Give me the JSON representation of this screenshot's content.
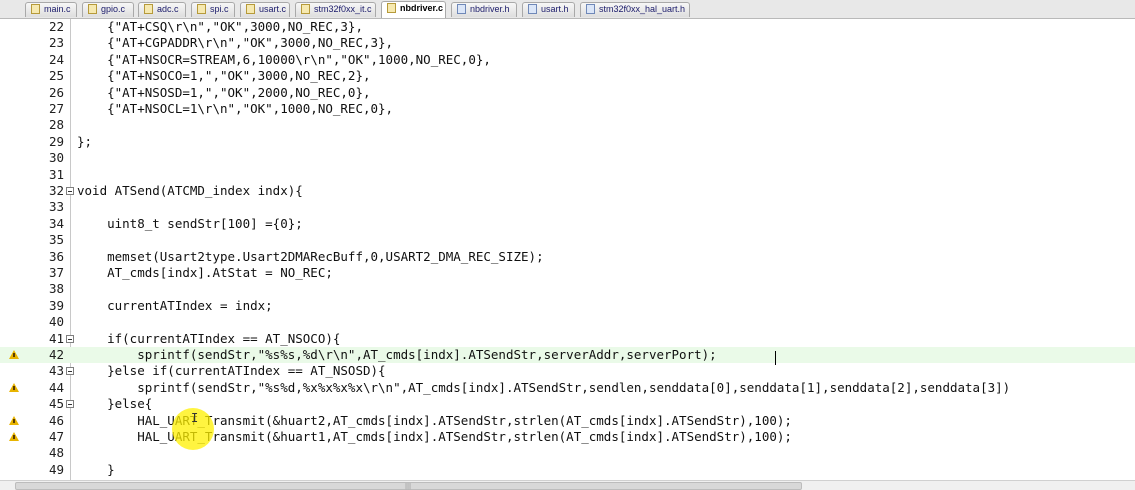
{
  "tabs": [
    {
      "label": "main.c",
      "type": "c"
    },
    {
      "label": "gpio.c",
      "type": "c"
    },
    {
      "label": "adc.c",
      "type": "c"
    },
    {
      "label": "spi.c",
      "type": "c"
    },
    {
      "label": "usart.c",
      "type": "c"
    },
    {
      "label": "stm32f0xx_it.c",
      "type": "c"
    },
    {
      "label": "nbdriver.c",
      "type": "c",
      "active": true
    },
    {
      "label": "nbdriver.h",
      "type": "h"
    },
    {
      "label": "usart.h",
      "type": "h"
    },
    {
      "label": "stm32f0xx_hal_uart.h",
      "type": "h"
    }
  ],
  "code_lines": [
    {
      "n": "22",
      "text": "    {\"AT+CSQ\\r\\n\",\"OK\",3000,NO_REC,3},"
    },
    {
      "n": "23",
      "text": "    {\"AT+CGPADDR\\r\\n\",\"OK\",3000,NO_REC,3},"
    },
    {
      "n": "24",
      "text": "    {\"AT+NSOCR=STREAM,6,10000\\r\\n\",\"OK\",1000,NO_REC,0},"
    },
    {
      "n": "25",
      "text": "    {\"AT+NSOCO=1,\",\"OK\",3000,NO_REC,2},"
    },
    {
      "n": "26",
      "text": "    {\"AT+NSOSD=1,\",\"OK\",2000,NO_REC,0},"
    },
    {
      "n": "27",
      "text": "    {\"AT+NSOCL=1\\r\\n\",\"OK\",1000,NO_REC,0},"
    },
    {
      "n": "28",
      "text": ""
    },
    {
      "n": "29",
      "text": "};"
    },
    {
      "n": "30",
      "text": ""
    },
    {
      "n": "31",
      "text": ""
    },
    {
      "n": "32",
      "text": "void ATSend(ATCMD_index indx){",
      "fold": true
    },
    {
      "n": "33",
      "text": ""
    },
    {
      "n": "34",
      "text": "    uint8_t sendStr[100] ={0};"
    },
    {
      "n": "35",
      "text": ""
    },
    {
      "n": "36",
      "text": "    memset(Usart2type.Usart2DMARecBuff,0,USART2_DMA_REC_SIZE);"
    },
    {
      "n": "37",
      "text": "    AT_cmds[indx].AtStat = NO_REC;"
    },
    {
      "n": "38",
      "text": ""
    },
    {
      "n": "39",
      "text": "    currentATIndex = indx;"
    },
    {
      "n": "40",
      "text": ""
    },
    {
      "n": "41",
      "text": "    if(currentATIndex == AT_NSOCO){",
      "fold": true
    },
    {
      "n": "42",
      "text": "        sprintf(sendStr,\"%s%s,%d\\r\\n\",AT_cmds[indx].ATSendStr,serverAddr,serverPort);",
      "warn": true,
      "current": true
    },
    {
      "n": "43",
      "text": "    }else if(currentATIndex == AT_NSOSD){",
      "fold": true
    },
    {
      "n": "44",
      "text": "        sprintf(sendStr,\"%s%d,%x%x%x%x\\r\\n\",AT_cmds[indx].ATSendStr,sendlen,senddata[0],senddata[1],senddata[2],senddata[3])",
      "warn": true
    },
    {
      "n": "45",
      "text": "    }else{",
      "fold": true
    },
    {
      "n": "46",
      "text": "        HAL_UART_Transmit(&huart2,AT_cmds[indx].ATSendStr,strlen(AT_cmds[indx].ATSendStr),100);",
      "warn": true
    },
    {
      "n": "47",
      "text": "        HAL_UART_Transmit(&huart1,AT_cmds[indx].ATSendStr,strlen(AT_cmds[indx].ATSendStr),100);",
      "warn": true
    },
    {
      "n": "48",
      "text": ""
    },
    {
      "n": "49",
      "text": "    }"
    }
  ]
}
